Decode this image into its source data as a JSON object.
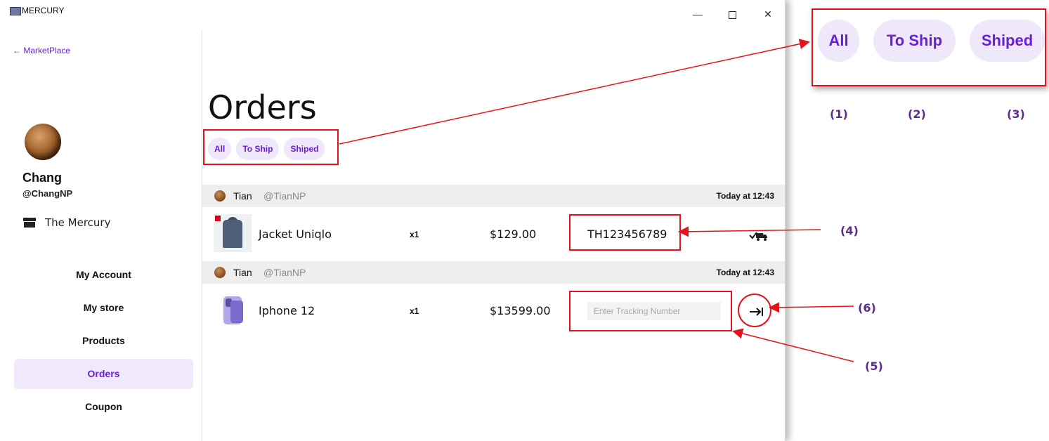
{
  "window": {
    "title": "MERCURY",
    "controls": {
      "minimize": "—",
      "close": "✕"
    }
  },
  "sidebar": {
    "back_label": "← MarketPlace",
    "user": {
      "name": "Chang",
      "handle": "@ChangNP"
    },
    "store": {
      "label": "The Mercury",
      "icon": "store-icon"
    },
    "nav": [
      {
        "label": "My Account",
        "active": false
      },
      {
        "label": "My store",
        "active": false
      },
      {
        "label": "Products",
        "active": false
      },
      {
        "label": "Orders",
        "active": true
      },
      {
        "label": "Coupon",
        "active": false
      }
    ]
  },
  "main": {
    "title": "Orders",
    "filters": [
      {
        "label": "All"
      },
      {
        "label": "To Ship"
      },
      {
        "label": "Shiped"
      }
    ],
    "orders": [
      {
        "buyer_name": "Tian",
        "buyer_handle": "@TianNP",
        "time": "Today at 12:43",
        "product": "Jacket Uniqlo",
        "qty": "x1",
        "price": "$129.00",
        "tracking": "TH123456789",
        "status_icon": "shipped-truck-icon"
      },
      {
        "buyer_name": "Tian",
        "buyer_handle": "@TianNP",
        "time": "Today at 12:43",
        "product": "Iphone 12",
        "qty": "x1",
        "price": "$13599.00",
        "tracking_placeholder": "Enter Tracking Number",
        "action_icon": "arrow-to-right-icon"
      }
    ]
  },
  "annotations": {
    "zoom_chips": [
      "All",
      "To Ship",
      "Shiped"
    ],
    "labels": [
      "(1)",
      "(2)",
      "(3)",
      "(4)",
      "(5)",
      "(6)"
    ],
    "accent_color": "#e4131b"
  },
  "colors": {
    "primary": "#6a1fd6",
    "chip_bg": "#efe8fb",
    "row_header_bg": "#eeeeee"
  }
}
